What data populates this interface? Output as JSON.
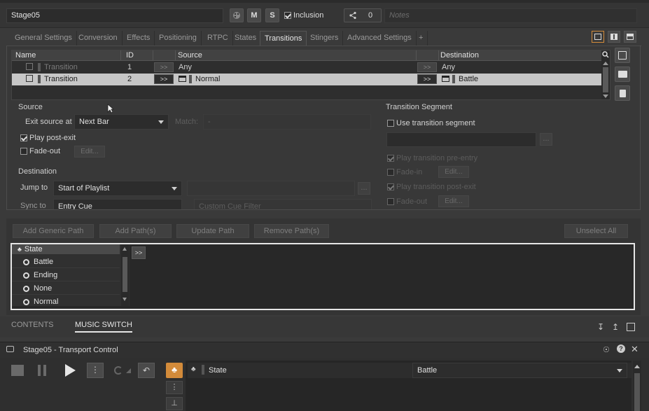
{
  "header": {
    "object_name": "Stage05",
    "m_label": "M",
    "s_label": "S",
    "inclusion_label": "Inclusion",
    "share_count": "0",
    "notes_placeholder": "Notes"
  },
  "tabs": [
    "General Settings",
    "Conversion",
    "Effects",
    "Positioning",
    "RTPC",
    "States",
    "Transitions",
    "Stingers",
    "Advanced Settings",
    "+"
  ],
  "active_tab": "Transitions",
  "transitions_table": {
    "columns": [
      "Name",
      "ID",
      "Source",
      "Destination"
    ],
    "rows": [
      {
        "name": "Transition",
        "id": "1",
        "go": ">>",
        "source": "Any",
        "go2": ">>",
        "destination": "Any"
      },
      {
        "name": "Transition",
        "id": "2",
        "go": ">>",
        "source": "Normal",
        "go2": ">>",
        "destination": "Battle"
      }
    ]
  },
  "source": {
    "section_label": "Source",
    "exit_label": "Exit source at",
    "exit_value": "Next Bar",
    "match_label": "Match:",
    "match_value": "-",
    "play_post_exit": "Play post-exit",
    "fade_out": "Fade-out",
    "edit": "Edit..."
  },
  "destination": {
    "section_label": "Destination",
    "jump_label": "Jump to",
    "jump_value": "Start of Playlist",
    "more": "...",
    "partial_left": "Sync to",
    "partial_value": "Entry Cue",
    "custom_cue_filter": "Custom Cue Filter"
  },
  "segment": {
    "section_label": "Transition Segment",
    "use_segment": "Use transition segment",
    "more": "...",
    "play_pre_entry": "Play transition pre-entry",
    "fade_in": "Fade-in",
    "edit": "Edit...",
    "play_post_exit": "Play transition post-exit",
    "fade_out": "Fade-out"
  },
  "path_buttons": {
    "add_generic": "Add Generic Path",
    "add_paths": "Add Path(s)",
    "update": "Update Path",
    "remove": "Remove Path(s)",
    "unselect": "Unselect All"
  },
  "state_tree": {
    "header": "State",
    "items": [
      "Battle",
      "Ending",
      "None",
      "Normal"
    ],
    "go": ">>"
  },
  "bottom_tabs": [
    "CONTENTS",
    "MUSIC SWITCH"
  ],
  "active_bottom_tab": "MUSIC SWITCH",
  "transport": {
    "title": "Stage05 - Transport Control",
    "state_label": "State",
    "state_value": "Battle"
  },
  "colors": {
    "accent": "#d38b3a",
    "selected_row": "#c6c6c6",
    "panel_bg": "#383838"
  }
}
